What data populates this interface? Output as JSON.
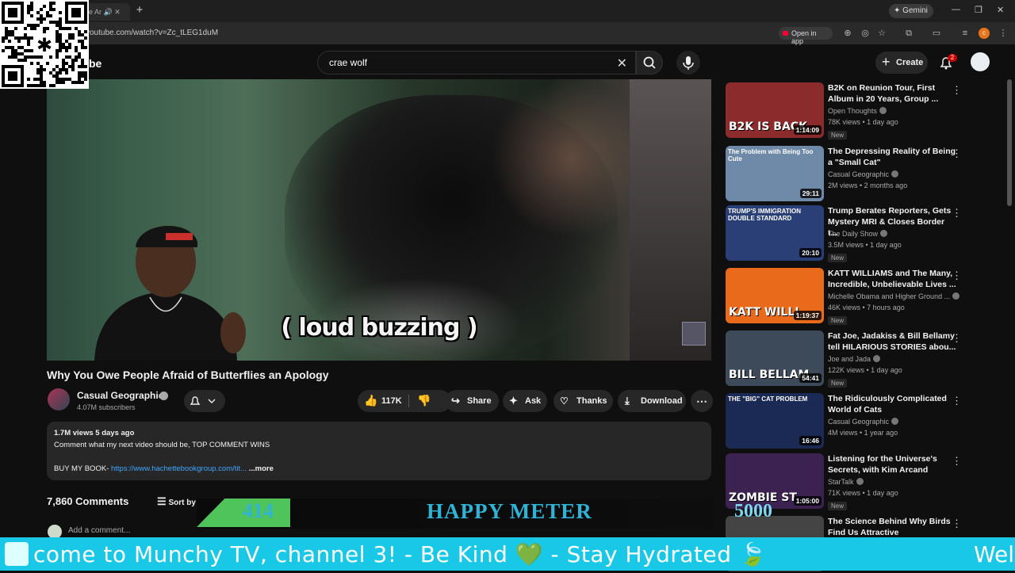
{
  "browser": {
    "tab_title": "e Ar",
    "new_tab": "+",
    "gemini_label": "Gemini",
    "url": "youtube.com/watch?v=Zc_tLEG1duM",
    "open_in_app": "Open in app",
    "profile_initial": "c",
    "window_controls": [
      "—",
      "❐",
      "✕"
    ]
  },
  "header": {
    "logo_text": "be",
    "search_value": "crae wolf",
    "create_label": "Create",
    "notif_count": "2"
  },
  "video": {
    "caption": "( loud buzzing )",
    "title": "Why You Owe People Afraid of Butterflies an Apology",
    "channel": "Casual Geographic",
    "subscribers": "4.07M subscribers",
    "likes": "117K",
    "share": "Share",
    "ask": "Ask",
    "thanks": "Thanks",
    "download": "Download"
  },
  "description": {
    "meta": "1.7M views  5 days ago",
    "line1": "Comment what my next video should be, TOP COMMENT WINS",
    "book_prefix": "BUY MY BOOK- ",
    "book_link": "https://www.hachettebookgroup.com/tit...",
    "more": "...more"
  },
  "comments": {
    "count": "7,860 Comments",
    "sort": "Sort by",
    "add_placeholder": "Add a comment..."
  },
  "overlay": {
    "meter_value": "414",
    "meter_label": "HAPPY METER",
    "counter": "5000",
    "ticker": "come to Munchy TV, channel 3!  - Be Kind  💚  - Stay Hydrated  🍃",
    "ticker_end": "Wel"
  },
  "sidebar": {
    "items": [
      {
        "title": "B2K on Reunion Tour, First Album in 20 Years, Group ...",
        "channel": "Open Thoughts",
        "meta": "78K views • 1 day ago",
        "badge": "New",
        "duration": "1:14:09",
        "thumb_text": "B2K IS BACK",
        "thumb_top": "",
        "color": "#8b2b2b"
      },
      {
        "title": "The Depressing Reality of Being a \"Small Cat\"",
        "channel": "Casual Geographic",
        "meta": "2M views • 2 months ago",
        "badge": "",
        "duration": "29:11",
        "thumb_text": "",
        "thumb_top": "The Problem with Being Too Cute",
        "color": "#6f8aa8"
      },
      {
        "title": "Trump Berates Reporters, Gets Mystery MRI & Closes Border t...",
        "channel": "The Daily Show",
        "meta": "3.5M views • 1 day ago",
        "badge": "New",
        "duration": "20:10",
        "thumb_text": "",
        "thumb_top": "TRUMP'S IMMIGRATION DOUBLE STANDARD",
        "color": "#2b3f77"
      },
      {
        "title": "KATT WILLIAMS and The Many, Incredible, Unbelievable Lives ...",
        "channel": "Michelle Obama  and Higher Ground ...",
        "meta": "46K views • 7 hours ago",
        "badge": "New",
        "duration": "1:19:37",
        "thumb_text": "KATT WILLI",
        "thumb_top": "",
        "color": "#e86a1a"
      },
      {
        "title": "Fat Joe, Jadakiss & Bill Bellamy tell HILARIOUS STORIES abou...",
        "channel": "Joe and Jada",
        "meta": "122K views • 1 day ago",
        "badge": "New",
        "duration": "54:41",
        "thumb_text": "BILL BELLAM",
        "thumb_top": "",
        "color": "#3d4a5a"
      },
      {
        "title": "The Ridiculously Complicated World of Cats",
        "channel": "Casual Geographic",
        "meta": "4M views • 1 year ago",
        "badge": "",
        "duration": "16:46",
        "thumb_text": "",
        "thumb_top": "THE \"BIG\" CAT PROBLEM",
        "color": "#1b2a55"
      },
      {
        "title": "Listening for the Universe's Secrets, with Kim Arcand",
        "channel": "StarTalk",
        "meta": "71K views • 1 day ago",
        "badge": "New",
        "duration": "1:05:00",
        "thumb_text": "ZOMBIE ST",
        "thumb_top": "",
        "color": "#3b2250"
      },
      {
        "title": "The Science Behind Why Birds Find Us Attractive",
        "channel": "",
        "meta": "",
        "badge": "",
        "duration": "",
        "thumb_text": "",
        "thumb_top": "",
        "color": "#444"
      }
    ]
  }
}
